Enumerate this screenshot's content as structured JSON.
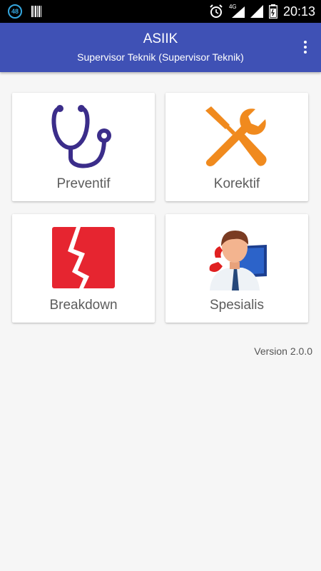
{
  "status_bar": {
    "badge": "48",
    "network": "4G",
    "time": "20:13"
  },
  "app_bar": {
    "title": "ASIIK",
    "subtitle": "Supervisor Teknik (Supervisor Teknik)"
  },
  "menu": [
    {
      "label": "Preventif",
      "icon": "stethoscope-icon"
    },
    {
      "label": "Korektif",
      "icon": "wrench-screwdriver-icon"
    },
    {
      "label": "Breakdown",
      "icon": "broken-page-icon"
    },
    {
      "label": "Spesialis",
      "icon": "support-agent-icon"
    }
  ],
  "footer": {
    "version": "Version 2.0.0"
  },
  "colors": {
    "app_bar": "#3f51b5",
    "stethoscope": "#3b2d8a",
    "tools": "#f08a1e",
    "breakdown": "#e62530"
  }
}
